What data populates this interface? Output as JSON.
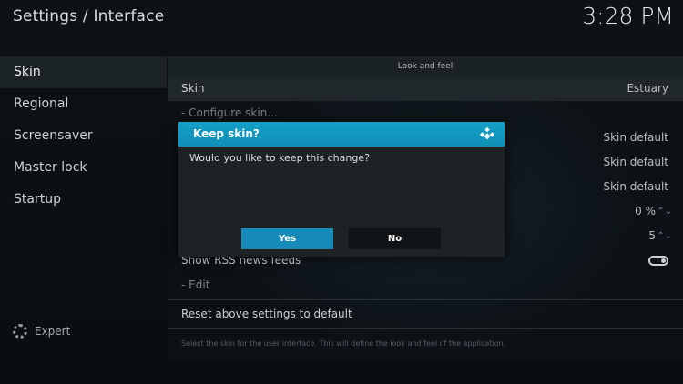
{
  "header": {
    "title": "Settings / Interface",
    "clock": "3:28 PM"
  },
  "sidebar": {
    "items": [
      {
        "label": "Skin",
        "active": true
      },
      {
        "label": "Regional"
      },
      {
        "label": "Screensaver"
      },
      {
        "label": "Master lock"
      },
      {
        "label": "Startup"
      }
    ],
    "expert_label": "Expert"
  },
  "settings": {
    "section_title": "Look and feel",
    "rows": [
      {
        "label": "Skin",
        "value": "Estuary"
      },
      {
        "label": "- Configure skin...",
        "value": ""
      },
      {
        "label": "",
        "value": "Skin default"
      },
      {
        "label": "",
        "value": "Skin default"
      },
      {
        "label": "",
        "value": "Skin default"
      },
      {
        "label": "",
        "value": "0 %"
      },
      {
        "label": "",
        "value": "5"
      },
      {
        "label": "Show RSS news feeds",
        "value": ""
      },
      {
        "label": "- Edit",
        "value": ""
      }
    ],
    "reset_label": "Reset above settings to default",
    "hint": "Select the skin for the user interface. This will define the look and feel of the application."
  },
  "dialog": {
    "title": "Keep skin?",
    "message": "Would you like to keep this change?",
    "yes_label": "Yes",
    "no_label": "No",
    "accent_color": "#149fc7"
  },
  "icons": {
    "logo": "kodi-logo-icon",
    "expert": "gear-icon",
    "spinner": "up-down-chevron-icon",
    "toggle": "toggle-switch-icon"
  }
}
